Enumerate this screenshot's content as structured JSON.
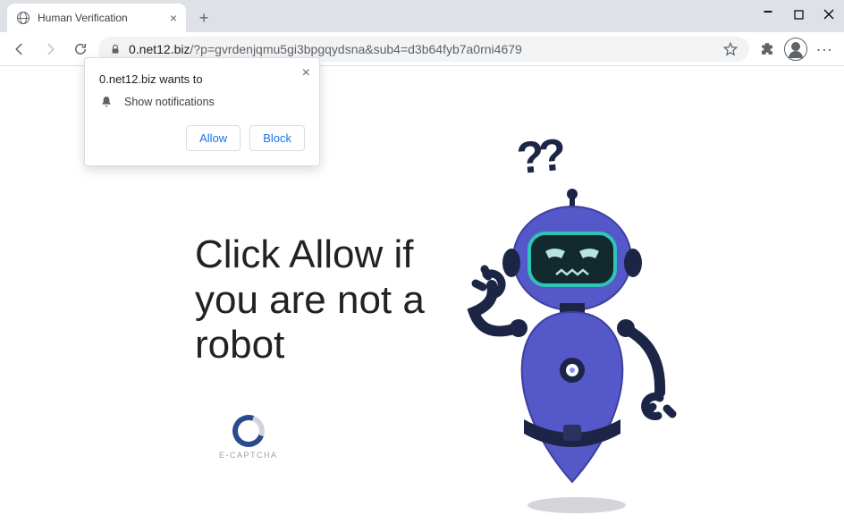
{
  "window": {
    "tab_title": "Human Verification",
    "url_host": "0.net12.biz",
    "url_path": "/?p=gvrdenjqmu5gi3bpgqydsna&sub4=d3b64fyb7a0rni4679"
  },
  "permission": {
    "title_prefix": "0.net12.biz",
    "title_suffix": " wants to",
    "item": "Show notifications",
    "allow": "Allow",
    "block": "Block"
  },
  "page": {
    "headline": "Click Allow if you are not a robot",
    "captcha_label": "E-CAPTCHA",
    "question_marks": "??"
  },
  "colors": {
    "robot_body": "#5558c8",
    "robot_dark": "#1d2547",
    "visor": "#12292e",
    "visor_outline": "#2ec4b6"
  }
}
